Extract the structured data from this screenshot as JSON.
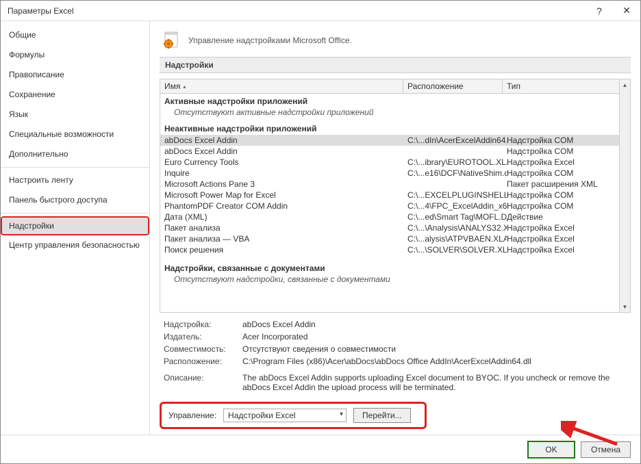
{
  "window": {
    "title": "Параметры Excel",
    "help": "?",
    "close": "✕"
  },
  "sidebar": {
    "items": [
      {
        "label": "Общие"
      },
      {
        "label": "Формулы"
      },
      {
        "label": "Правописание"
      },
      {
        "label": "Сохранение"
      },
      {
        "label": "Язык"
      },
      {
        "label": "Специальные возможности"
      },
      {
        "label": "Дополнительно"
      },
      {
        "label": "Настроить ленту"
      },
      {
        "label": "Панель быстрого доступа"
      },
      {
        "label": "Надстройки"
      },
      {
        "label": "Центр управления безопасностью"
      }
    ],
    "selected_index": 9
  },
  "content": {
    "heading": "Управление надстройками Microsoft Office.",
    "section_label": "Надстройки",
    "columns": {
      "name": "Имя",
      "location": "Расположение",
      "type": "Тип"
    },
    "groups": {
      "active": {
        "title": "Активные надстройки приложений",
        "empty": "Отсутствуют активные надстройки приложений"
      },
      "inactive": {
        "title": "Неактивные надстройки приложений"
      },
      "doc": {
        "title": "Надстройки, связанные с документами",
        "empty": "Отсутствуют надстройки, связанные с документами"
      }
    },
    "inactive_rows": [
      {
        "name": "abDocs Excel Addin",
        "loc": "C:\\...dIn\\AcerExcelAddin64.dll",
        "type": "Надстройка COM",
        "selected": true
      },
      {
        "name": "abDocs Excel Addin",
        "loc": "",
        "type": "Надстройка COM"
      },
      {
        "name": "Euro Currency Tools",
        "loc": "C:\\...ibrary\\EUROTOOL.XLAM",
        "type": "Надстройка Excel"
      },
      {
        "name": "Inquire",
        "loc": "C:\\...e16\\DCF\\NativeShim.dll",
        "type": "Надстройка COM"
      },
      {
        "name": "Microsoft Actions Pane 3",
        "loc": "",
        "type": "Пакет расширения XML"
      },
      {
        "name": "Microsoft Power Map for Excel",
        "loc": "C:\\...EXCELPLUGINSHELL.DLL",
        "type": "Надстройка COM"
      },
      {
        "name": "PhantomPDF Creator COM Addin",
        "loc": "C:\\...4\\FPC_ExcelAddin_x64.dll",
        "type": "Надстройка COM"
      },
      {
        "name": "Дата (XML)",
        "loc": "C:\\...ed\\Smart Tag\\MOFL.DLL",
        "type": "Действие"
      },
      {
        "name": "Пакет анализа",
        "loc": "C:\\...\\Analysis\\ANALYS32.XLL",
        "type": "Надстройка Excel"
      },
      {
        "name": "Пакет анализа — VBA",
        "loc": "C:\\...alysis\\ATPVBAEN.XLAM",
        "type": "Надстройка Excel"
      },
      {
        "name": "Поиск решения",
        "loc": "C:\\...\\SOLVER\\SOLVER.XLAM",
        "type": "Надстройка Excel"
      }
    ],
    "details": {
      "addin_label": "Надстройка:",
      "addin_value": "abDocs Excel Addin",
      "publisher_label": "Издатель:",
      "publisher_value": "Acer Incorporated",
      "compat_label": "Совместимость:",
      "compat_value": "Отсутствуют сведения о совместимости",
      "location_label": "Расположение:",
      "location_value": "C:\\Program Files (x86)\\Acer\\abDocs\\abDocs Office AddIn\\AcerExcelAddin64.dll",
      "desc_label": "Описание:",
      "desc_value": "The abDocs Excel Addin supports uploading Excel document to BYOC. If you uncheck or remove the abDocs Excel Addin the upload process will be terminated."
    },
    "manage": {
      "label": "Управление:",
      "selected": "Надстройки Excel",
      "go": "Перейти..."
    }
  },
  "footer": {
    "ok": "OK",
    "cancel": "Отмена"
  }
}
